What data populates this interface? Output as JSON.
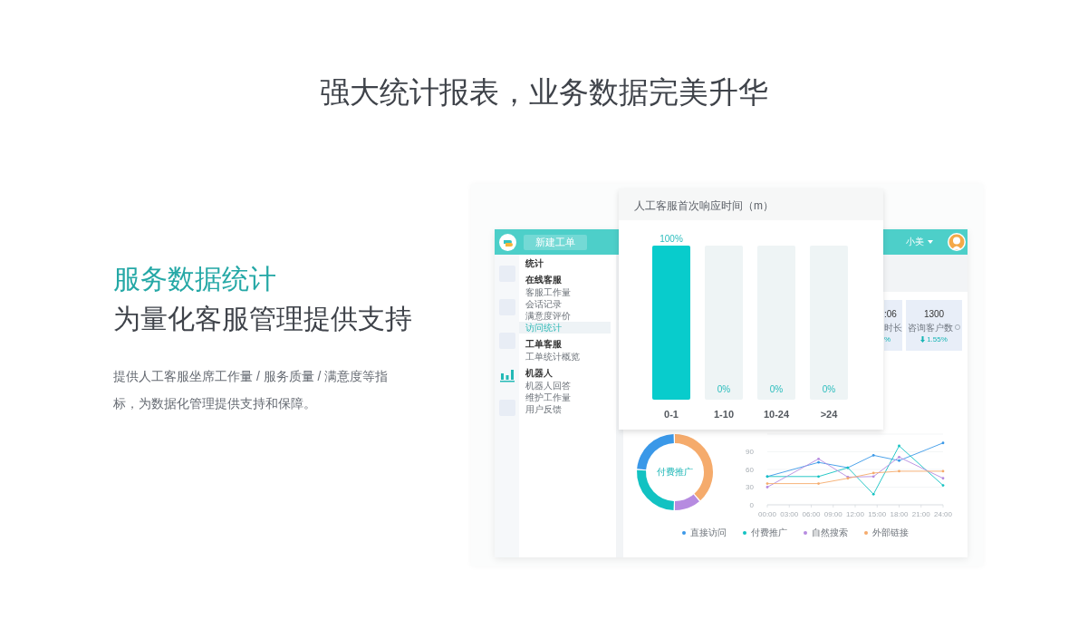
{
  "headline": "强大统计报表，业务数据完美升华",
  "feature": {
    "title": "服务数据统计",
    "subtitle": "为量化客服管理提供支持",
    "description": "提供人工客服坐席工作量 / 服务质量 / 满意度等指标，为数据化管理提供支持和保障。"
  },
  "app": {
    "topbar": {
      "new_button": "新建工单",
      "user_name": "小美"
    },
    "rail_icons": [
      {
        "kind": "square",
        "selected": false
      },
      {
        "kind": "square",
        "selected": false
      },
      {
        "kind": "square",
        "selected": false
      },
      {
        "kind": "bar-chart",
        "selected": true
      },
      {
        "kind": "square",
        "selected": false
      }
    ],
    "sidebar": {
      "title": "统计",
      "groups": [
        {
          "label": "在线客服",
          "items": [
            {
              "label": "客服工作量",
              "selected": false
            },
            {
              "label": "会话记录",
              "selected": false
            },
            {
              "label": "满意度评价",
              "selected": false
            },
            {
              "label": "访问统计",
              "selected": true
            }
          ]
        },
        {
          "label": "工单客服",
          "items": [
            {
              "label": "工单统计概览",
              "selected": false
            }
          ]
        },
        {
          "label": "机器人",
          "items": [
            {
              "label": "机器人回答",
              "selected": false
            },
            {
              "label": "维护工作量",
              "selected": false
            },
            {
              "label": "用户反馈",
              "selected": false
            }
          ]
        }
      ]
    },
    "stat_cards": [
      {
        "value": ":06",
        "label": "时长",
        "change": "%"
      },
      {
        "value": "1300",
        "label": "咨询客户数",
        "change": "1.55%",
        "decrease": true,
        "info": true
      }
    ],
    "donut": {
      "center_label": "付费推广"
    },
    "line_chart": {
      "chart_data": {
        "type": "line",
        "x": [
          0,
          7,
          11,
          14.5,
          18,
          24
        ],
        "xlim": [
          0,
          24
        ],
        "ylim": [
          0,
          120
        ],
        "grid": true,
        "xticks": [
          {
            "value": 0,
            "label": "00:00"
          },
          {
            "value": 3,
            "label": "03:00"
          },
          {
            "value": 6,
            "label": "06:00"
          },
          {
            "value": 9,
            "label": "09:00"
          },
          {
            "value": 12,
            "label": "12:00"
          },
          {
            "value": 15,
            "label": "15:00"
          },
          {
            "value": 18,
            "label": "18:00"
          },
          {
            "value": 21,
            "label": "21:00"
          },
          {
            "value": 24,
            "label": "24:00"
          }
        ],
        "yticks": [
          {
            "value": 0,
            "label": "0"
          },
          {
            "value": 30,
            "label": "30"
          },
          {
            "value": 60,
            "label": "60"
          },
          {
            "value": 90,
            "label": "90"
          }
        ],
        "series": [
          {
            "name": "直接访问",
            "color": "#3a98e8",
            "values": [
              48,
              72,
              63,
              84,
              75,
              105
            ]
          },
          {
            "name": "付费推广",
            "color": "#12c2c2",
            "values": [
              48,
              48,
              63,
              18,
              100,
              33
            ]
          },
          {
            "name": "自然搜索",
            "color": "#b68be0",
            "values": [
              30,
              78,
              47,
              48,
              81,
              45
            ]
          },
          {
            "name": "外部链接",
            "color": "#f5ab6c",
            "values": [
              36,
              36,
              45,
              54,
              57,
              57
            ]
          }
        ]
      }
    },
    "popup": {
      "title": "人工客服首次响应时间（m）",
      "chart_data": {
        "type": "bar",
        "categories": [
          "0-1",
          "1-10",
          "10-24",
          ">24"
        ],
        "values": [
          100,
          0,
          0,
          0
        ],
        "ylim": [
          0,
          100
        ],
        "value_labels": [
          "100%",
          "0%",
          "0%",
          "0%"
        ]
      }
    }
  }
}
